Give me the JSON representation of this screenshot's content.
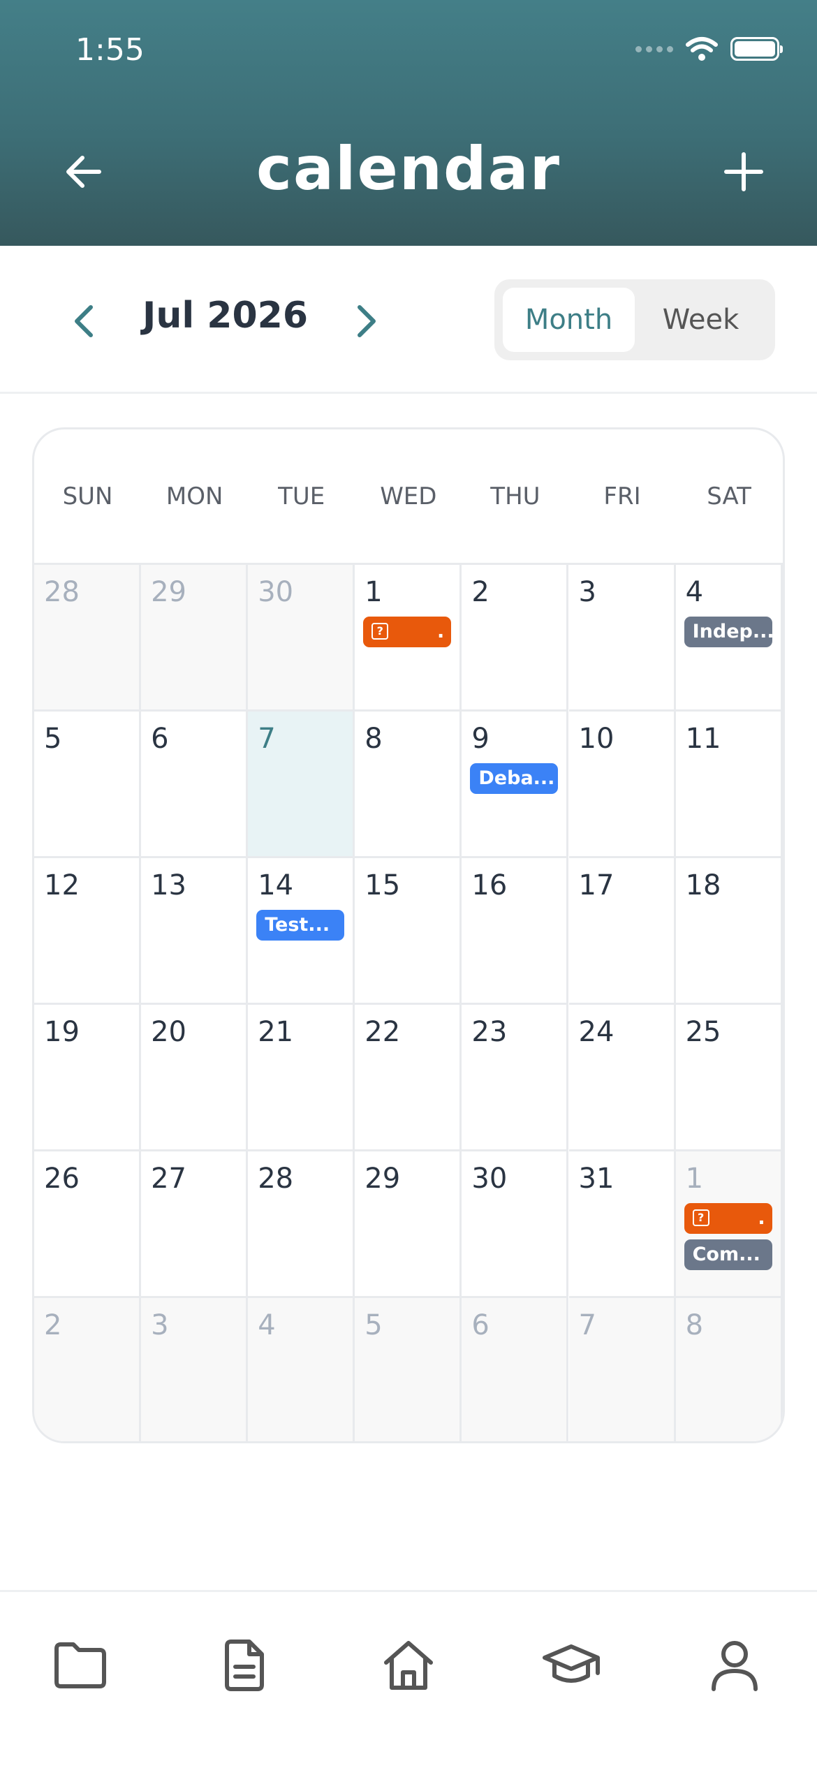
{
  "status_bar": {
    "time": "1:55"
  },
  "header": {
    "title": "calendar"
  },
  "toolbar": {
    "month_label": "Jul 2026",
    "view_options": [
      "Month",
      "Week"
    ],
    "active_view": "Month"
  },
  "weekdays": [
    "SUN",
    "MON",
    "TUE",
    "WED",
    "THU",
    "FRI",
    "SAT"
  ],
  "days": [
    {
      "n": "28",
      "other": true
    },
    {
      "n": "29",
      "other": true
    },
    {
      "n": "30",
      "other": true
    },
    {
      "n": "1",
      "events": [
        {
          "type": "orange",
          "label": "?",
          "suffix": "."
        }
      ]
    },
    {
      "n": "2"
    },
    {
      "n": "3"
    },
    {
      "n": "4",
      "events": [
        {
          "type": "slate",
          "label": "Indep..."
        }
      ]
    },
    {
      "n": "5"
    },
    {
      "n": "6"
    },
    {
      "n": "7",
      "today": true
    },
    {
      "n": "8"
    },
    {
      "n": "9",
      "events": [
        {
          "type": "blue",
          "label": "Deba..."
        }
      ]
    },
    {
      "n": "10"
    },
    {
      "n": "11"
    },
    {
      "n": "12"
    },
    {
      "n": "13"
    },
    {
      "n": "14",
      "events": [
        {
          "type": "blue",
          "label": "Test..."
        }
      ]
    },
    {
      "n": "15"
    },
    {
      "n": "16"
    },
    {
      "n": "17"
    },
    {
      "n": "18"
    },
    {
      "n": "19"
    },
    {
      "n": "20"
    },
    {
      "n": "21"
    },
    {
      "n": "22"
    },
    {
      "n": "23"
    },
    {
      "n": "24"
    },
    {
      "n": "25"
    },
    {
      "n": "26"
    },
    {
      "n": "27"
    },
    {
      "n": "28"
    },
    {
      "n": "29"
    },
    {
      "n": "30"
    },
    {
      "n": "31"
    },
    {
      "n": "1",
      "other": true,
      "events": [
        {
          "type": "orange",
          "label": "?",
          "suffix": "."
        },
        {
          "type": "slate",
          "label": "Com..."
        }
      ]
    },
    {
      "n": "2",
      "other": true
    },
    {
      "n": "3",
      "other": true
    },
    {
      "n": "4",
      "other": true
    },
    {
      "n": "5",
      "other": true
    },
    {
      "n": "6",
      "other": true
    },
    {
      "n": "7",
      "other": true
    },
    {
      "n": "8",
      "other": true
    }
  ],
  "bottom_nav": [
    "folder-icon",
    "document-icon",
    "home-icon",
    "graduation-cap-icon",
    "profile-icon"
  ],
  "colors": {
    "header": "#447f88",
    "accent": "#3d7e86",
    "event_orange": "#e8590c",
    "event_blue": "#3b82f6",
    "event_slate": "#6b778a"
  }
}
